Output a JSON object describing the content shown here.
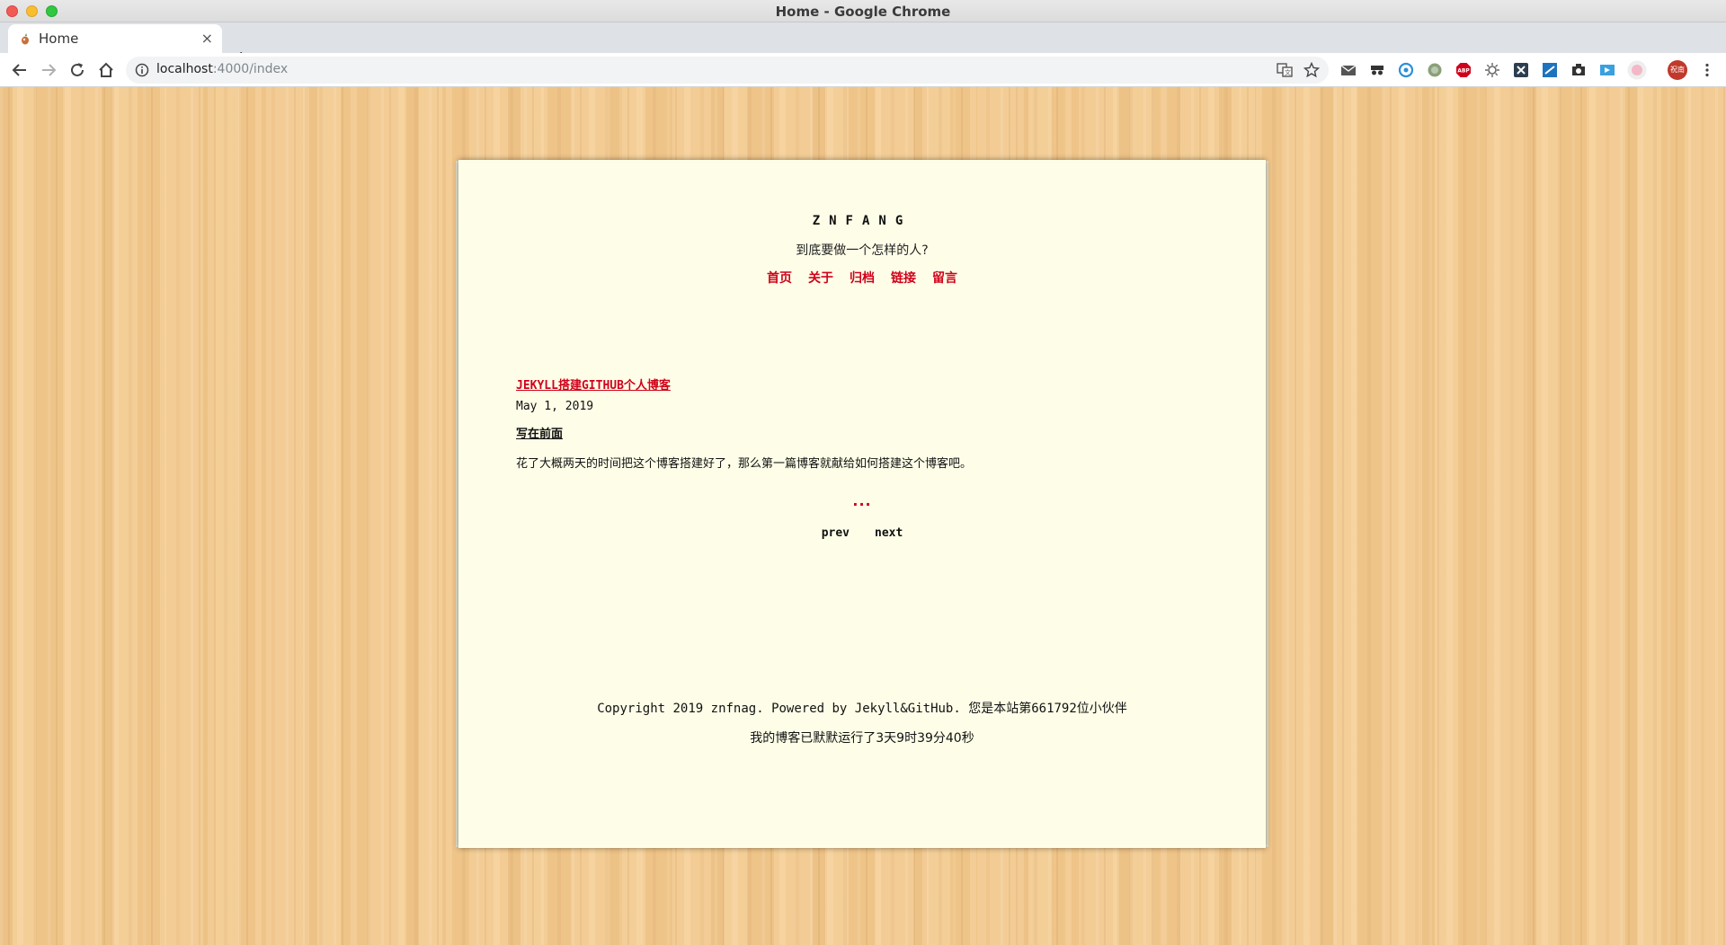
{
  "window": {
    "title": "Home - Google Chrome"
  },
  "tab": {
    "title": "Home",
    "close_glyph": "×",
    "new_tab_glyph": "+"
  },
  "toolbar": {
    "url_host": "localhost",
    "url_path": ":4000/index",
    "extensions": [
      "mail-icon",
      "incognito-icon",
      "circle-blue-icon",
      "circle-green-icon",
      "adblock-icon",
      "gear-extension-icon",
      "x-extension-icon",
      "s-extension-icon",
      "camera-icon",
      "cast-icon",
      "pink-extension-icon",
      "profile-avatar",
      "menu-icon"
    ],
    "avatar_text": "祝南"
  },
  "site": {
    "title": "ZNFANG",
    "subtitle": "到底要做一个怎样的人?",
    "nav": [
      "首页",
      "关于",
      "归档",
      "链接",
      "留言"
    ]
  },
  "post": {
    "title": "JEKYLL搭建GITHUB个人博客",
    "date": "May 1, 2019",
    "subheading": "写在前面",
    "excerpt": "花了大概两天的时间把这个博客搭建好了，那么第一篇博客就献给如何搭建这个博客吧。",
    "more": "..."
  },
  "pager": {
    "prev": "prev",
    "next": "next"
  },
  "footer": {
    "copyright": "Copyright 2019 znfnag. Powered by Jekyll&GitHub. 您是本站第661792位小伙伴",
    "runtime": "我的博客已默默运行了3天9时39分40秒"
  },
  "colors": {
    "accent": "#d0021b",
    "paper": "#fefee8",
    "wood": "#f2c98f"
  }
}
